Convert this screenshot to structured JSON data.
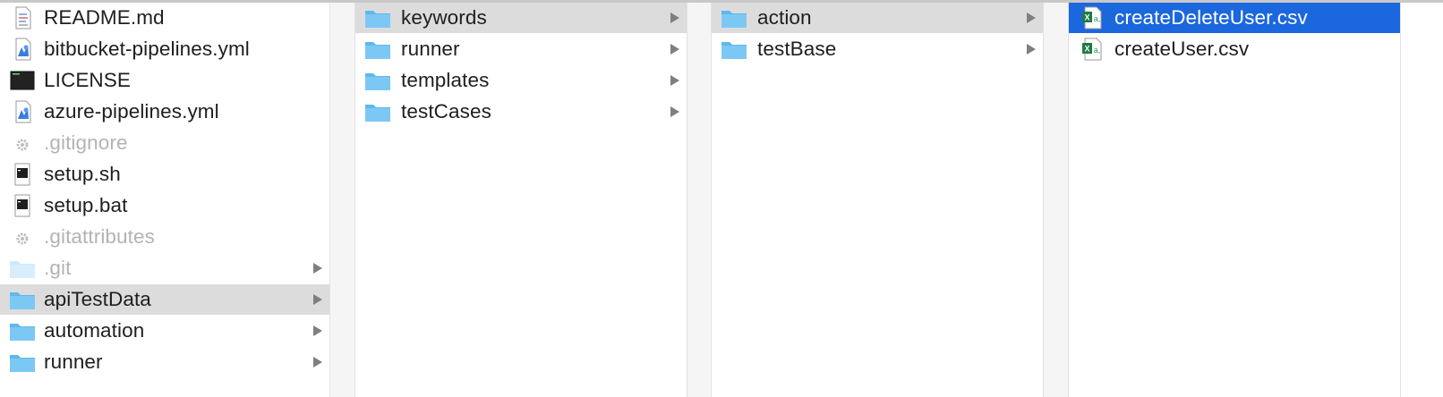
{
  "columns": [
    {
      "items": [
        {
          "label": "README.md",
          "icon": "markdown-file-icon"
        },
        {
          "label": "bitbucket-pipelines.yml",
          "icon": "yml-file-icon"
        },
        {
          "label": "LICENSE",
          "icon": "terminal-file-icon"
        },
        {
          "label": "azure-pipelines.yml",
          "icon": "yml-file-icon"
        },
        {
          "label": ".gitignore",
          "icon": "gear-icon"
        },
        {
          "label": "setup.sh",
          "icon": "shell-script-icon"
        },
        {
          "label": "setup.bat",
          "icon": "shell-script-icon"
        },
        {
          "label": ".gitattributes",
          "icon": "gear-icon"
        },
        {
          "label": ".git",
          "icon": "folder-icon"
        },
        {
          "label": "apiTestData",
          "icon": "folder-icon",
          "selected": "path"
        },
        {
          "label": "automation",
          "icon": "folder-icon"
        },
        {
          "label": "runner",
          "icon": "folder-icon"
        }
      ]
    },
    {
      "items": [
        {
          "label": "keywords",
          "icon": "folder-icon",
          "selected": "path"
        },
        {
          "label": "runner",
          "icon": "folder-icon"
        },
        {
          "label": "templates",
          "icon": "folder-icon"
        },
        {
          "label": "testCases",
          "icon": "folder-icon"
        }
      ]
    },
    {
      "items": [
        {
          "label": "action",
          "icon": "folder-icon",
          "selected": "path"
        },
        {
          "label": "testBase",
          "icon": "folder-icon"
        }
      ]
    },
    {
      "items": [
        {
          "label": "createDeleteUser.csv",
          "icon": "csv-file-icon",
          "selected": "active"
        },
        {
          "label": "createUser.csv",
          "icon": "csv-file-icon"
        }
      ]
    }
  ],
  "colors": {
    "selection_active": "#1b67dd",
    "selection_path": "#dcdcdc",
    "folder": "#7cc8f5"
  }
}
